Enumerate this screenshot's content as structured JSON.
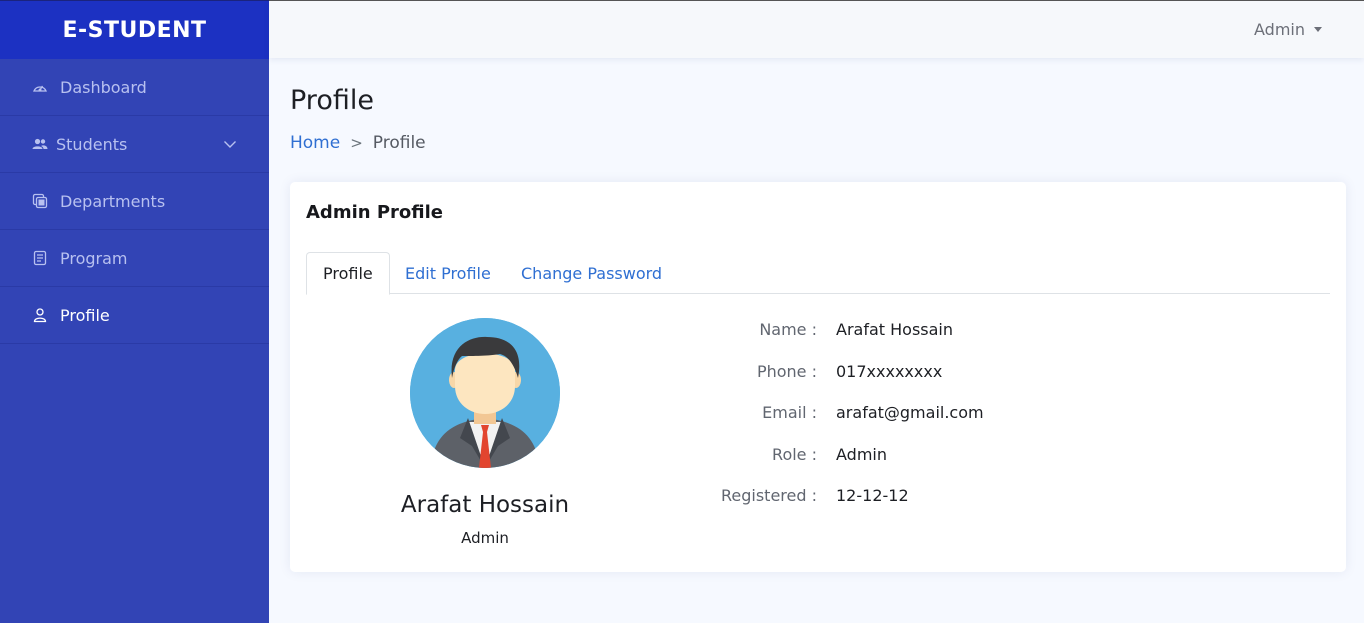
{
  "brand": {
    "name": "E-STUDENT",
    "color": "#1c31c2",
    "sidebar_color": "#3244b5"
  },
  "sidebar": {
    "items": [
      {
        "label": "Dashboard",
        "icon": "speedometer-icon"
      },
      {
        "label": "Students",
        "icon": "people-icon",
        "has_submenu": true
      },
      {
        "label": "Departments",
        "icon": "layers-icon"
      },
      {
        "label": "Program",
        "icon": "journal-icon"
      },
      {
        "label": "Profile",
        "icon": "person-icon",
        "active": true
      }
    ]
  },
  "header": {
    "user": "Admin"
  },
  "page": {
    "title": "Profile",
    "breadcrumb": {
      "home": "Home",
      "separator": ">",
      "current": "Profile"
    }
  },
  "card": {
    "title": "Admin Profile",
    "tabs": [
      {
        "label": "Profile",
        "active": true
      },
      {
        "label": "Edit Profile",
        "active": false
      },
      {
        "label": "Change Password",
        "active": false
      }
    ],
    "profile": {
      "name": "Arafat Hossain",
      "role": "Admin"
    },
    "details": [
      {
        "label": "Name :",
        "value": "Arafat Hossain"
      },
      {
        "label": "Phone :",
        "value": "017xxxxxxxx"
      },
      {
        "label": "Email :",
        "value": "arafat@gmail.com"
      },
      {
        "label": "Role :",
        "value": "Admin"
      },
      {
        "label": "Registered :",
        "value": "12-12-12"
      }
    ]
  },
  "colors": {
    "link": "#2f6fd2",
    "avatar_bg": "#58b0e0"
  }
}
